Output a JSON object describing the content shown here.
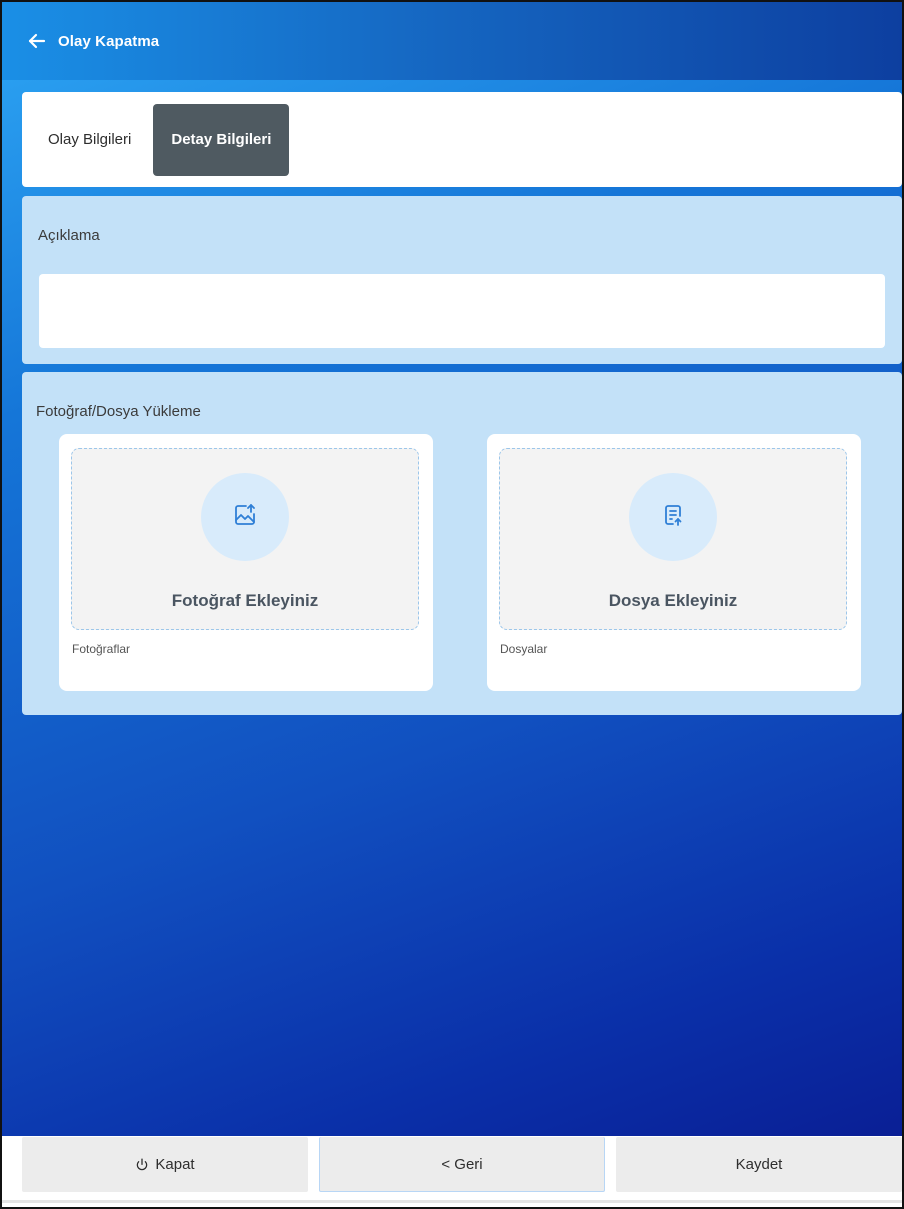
{
  "header": {
    "title": "Olay Kapatma"
  },
  "tabs": [
    {
      "label": "Olay Bilgileri",
      "active": false
    },
    {
      "label": "Detay Bilgileri",
      "active": true
    }
  ],
  "description": {
    "label": "Açıklama",
    "value": "",
    "placeholder": ""
  },
  "upload": {
    "label": "Fotoğraf/Dosya Yükleme",
    "photo": {
      "button_label": "Fotoğraf Ekleyiniz",
      "caption": "Fotoğraflar",
      "icon": "image-upload-icon"
    },
    "file": {
      "button_label": "Dosya Ekleyiniz",
      "caption": "Dosyalar",
      "icon": "file-upload-icon"
    }
  },
  "footer": {
    "close_label": "Kapat",
    "back_label": "< Geri",
    "save_label": "Kaydet"
  },
  "colors": {
    "header_start": "#1a8fe6",
    "header_end": "#0d3fa0",
    "panel_bg": "#c3e1f8",
    "active_tab_bg": "#4f5a61",
    "icon_blue": "#2f7fd6"
  }
}
